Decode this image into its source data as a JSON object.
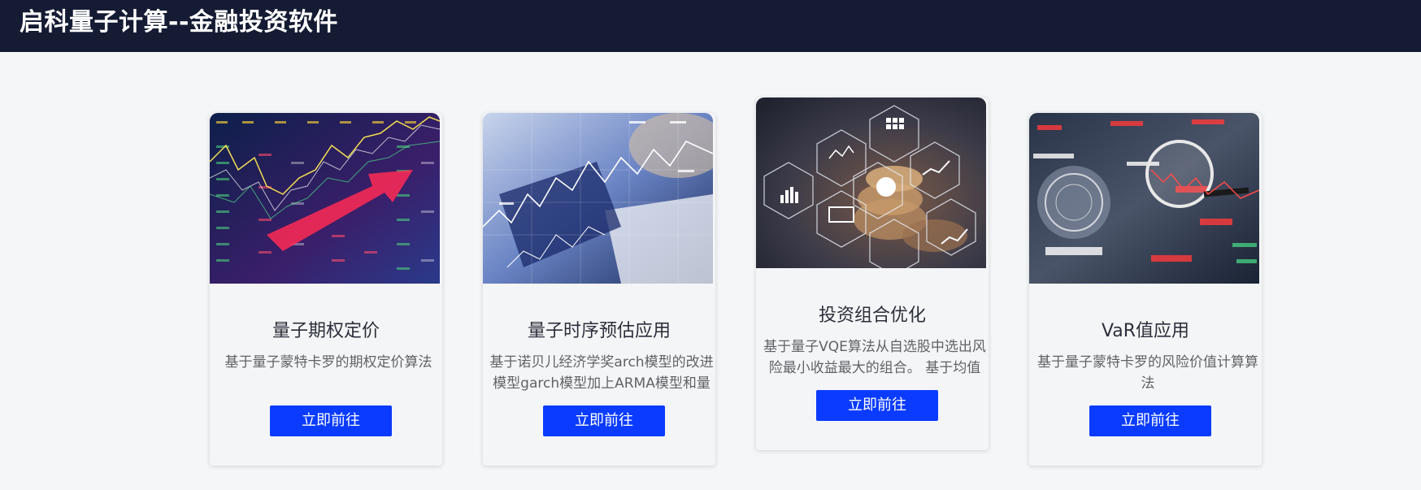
{
  "header": {
    "title": "启科量子计算--金融投资软件"
  },
  "cards": [
    {
      "title": "量子期权定价",
      "description": "基于量子蒙特卡罗的期权定价算法",
      "button_label": "立即前往",
      "image": "stock-market-chart-image"
    },
    {
      "title": "量子时序预估应用",
      "description": "基于诺贝儿经济学奖arch模型的改进模型garch模型加上ARMA模型和量",
      "button_label": "立即前往",
      "image": "financial-analysis-laptop-image"
    },
    {
      "title": "投资组合优化",
      "description": "基于量子VQE算法从自选股中选出风险最小收益最大的组合。 基于均值方",
      "button_label": "立即前往",
      "image": "investment-portfolio-hexagon-image"
    },
    {
      "title": "VaR值应用",
      "description": "基于量子蒙特卡罗的风险价值计算算法",
      "button_label": "立即前往",
      "image": "magnifier-market-data-image"
    }
  ],
  "colors": {
    "header_bg": "#141b33",
    "page_bg": "#f5f6f8",
    "button_bg": "#0a3bff"
  }
}
